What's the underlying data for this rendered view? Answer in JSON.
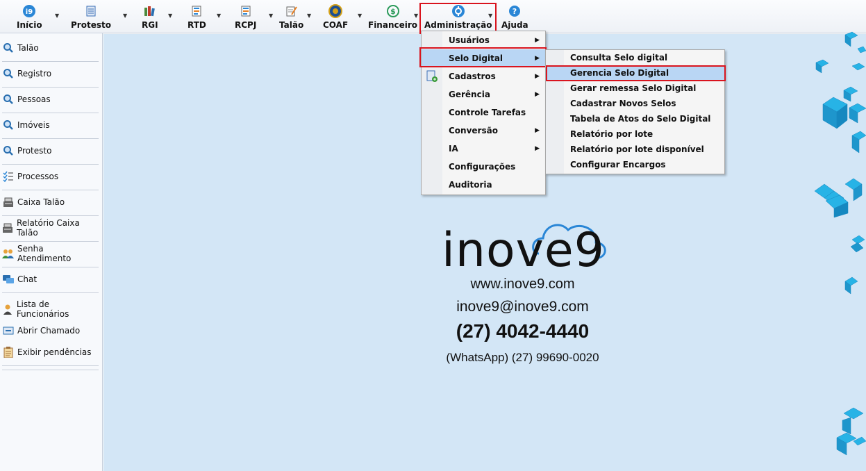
{
  "toolbar": {
    "items": [
      {
        "label": "Início",
        "icon": "i9-icon"
      },
      {
        "label": "Protesto",
        "icon": "document-icon"
      },
      {
        "label": "RGI",
        "icon": "books-icon"
      },
      {
        "label": "RTD",
        "icon": "list-document-icon"
      },
      {
        "label": "RCPJ",
        "icon": "list-document-icon"
      },
      {
        "label": "Talão",
        "icon": "pencil-document-icon"
      },
      {
        "label": "COAF",
        "icon": "coaf-emblem-icon"
      },
      {
        "label": "Financeiro",
        "icon": "money-cycle-icon"
      },
      {
        "label": "Administração",
        "icon": "admin-gear-icon"
      },
      {
        "label": "Ajuda",
        "icon": "help-icon"
      }
    ]
  },
  "sidebar": {
    "items": [
      {
        "label": "Talão",
        "icon": "search-icon"
      },
      {
        "label": "Registro",
        "icon": "search-icon"
      },
      {
        "label": "Pessoas",
        "icon": "search-icon"
      },
      {
        "label": "Imóveis",
        "icon": "search-icon"
      },
      {
        "label": "Protesto",
        "icon": "search-icon"
      },
      {
        "label": "Processos",
        "icon": "checklist-icon"
      },
      {
        "label": "Caixa Talão",
        "icon": "cash-register-icon"
      },
      {
        "label": "Relatório Caixa Talão",
        "icon": "cash-register-icon"
      },
      {
        "label": "Senha Atendimento",
        "icon": "users-icon"
      },
      {
        "label": "Chat",
        "icon": "chat-icon"
      },
      {
        "label": "Lista de Funcionários",
        "icon": "employee-icon"
      },
      {
        "label": "Abrir Chamado",
        "icon": "ticket-icon"
      },
      {
        "label": "Exibir pendências",
        "icon": "clipboard-icon"
      }
    ]
  },
  "admin_menu": {
    "items": [
      {
        "label": "Usuários",
        "submenu": true
      },
      {
        "label": "Selo Digital",
        "submenu": true,
        "active": true
      },
      {
        "label": "Cadastros",
        "submenu": true
      },
      {
        "label": "Gerência",
        "submenu": true
      },
      {
        "label": "Controle Tarefas",
        "submenu": false
      },
      {
        "label": "Conversão",
        "submenu": true
      },
      {
        "label": "IA",
        "submenu": true
      },
      {
        "label": "Configurações",
        "submenu": false
      },
      {
        "label": "Auditoria",
        "submenu": false
      }
    ]
  },
  "selo_menu": {
    "items": [
      {
        "label": "Consulta Selo digital"
      },
      {
        "label": "Gerencia Selo Digital",
        "active": true
      },
      {
        "label": "Gerar remessa Selo Digital"
      },
      {
        "label": "Cadastrar Novos Selos"
      },
      {
        "label": "Tabela de Atos do Selo Digital"
      },
      {
        "label": "Relatório por lote"
      },
      {
        "label": "Relatório por lote disponível"
      },
      {
        "label": "Configurar Encargos"
      }
    ]
  },
  "brand": {
    "logo_text": "inove9",
    "website": "www.inove9.com",
    "email": "inove9@inove9.com",
    "phone": "(27) 4042-4440",
    "whatsapp": "(WhatsApp) (27) 99690-0020"
  },
  "colors": {
    "highlight_red": "#d9141e",
    "menu_active": "#b9d6f4",
    "main_bg": "#d3e6f6",
    "brand_blue": "#2a86d6"
  }
}
